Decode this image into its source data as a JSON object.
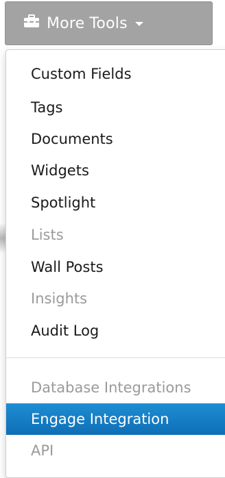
{
  "button": {
    "label": "More Tools",
    "icon": "toolbox-icon",
    "caret_icon": "caret-down-icon",
    "background": "#a3a3a3"
  },
  "menu": {
    "group1": [
      {
        "label": "Custom Fields",
        "enabled": true
      },
      {
        "label": "Tags",
        "enabled": true
      },
      {
        "label": "Documents",
        "enabled": true
      },
      {
        "label": "Widgets",
        "enabled": true
      },
      {
        "label": "Spotlight",
        "enabled": true
      },
      {
        "label": "Lists",
        "enabled": false
      },
      {
        "label": "Wall Posts",
        "enabled": true
      },
      {
        "label": "Insights",
        "enabled": false
      },
      {
        "label": "Audit Log",
        "enabled": true
      }
    ],
    "group2": [
      {
        "label": "Database Integrations",
        "enabled": false
      },
      {
        "label": "Engage Integration",
        "enabled": true,
        "highlighted": true
      },
      {
        "label": "API",
        "enabled": false
      }
    ],
    "highlight_color": "#1a84cc",
    "disabled_color": "#9a9a9a"
  }
}
